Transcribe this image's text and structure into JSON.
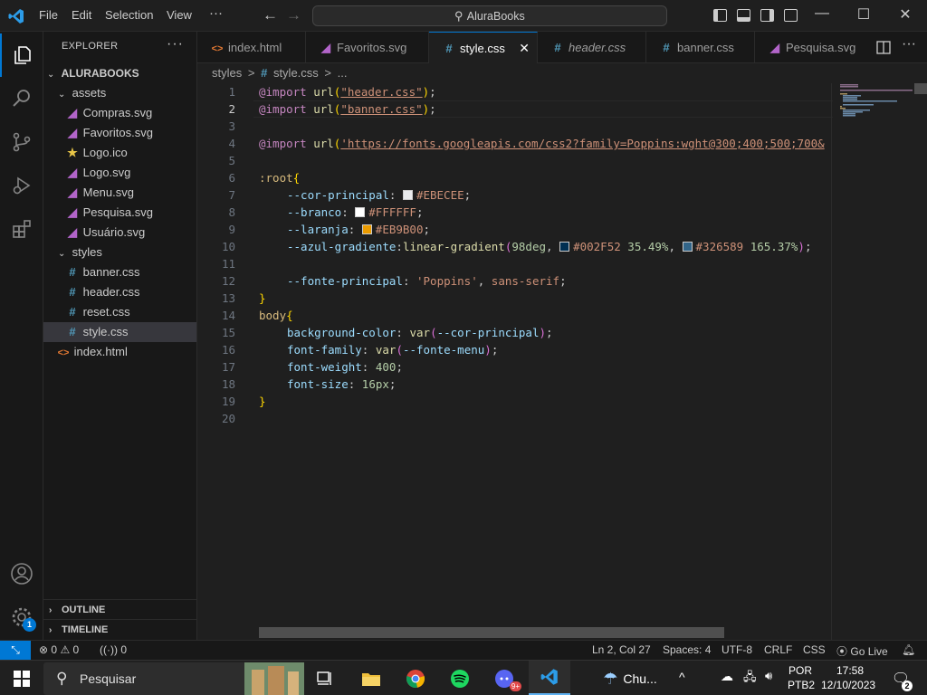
{
  "titlebar": {
    "menu": [
      "File",
      "Edit",
      "Selection",
      "View"
    ],
    "more": "···",
    "search_text": "AluraBooks",
    "minimize": "—",
    "maximize": "☐",
    "close": "✕"
  },
  "sidebar": {
    "title": "EXPLORER",
    "more": "···",
    "root": "ALURABOOKS",
    "tree": [
      {
        "label": "assets",
        "kind": "folder"
      },
      {
        "label": "Compras.svg",
        "kind": "svg"
      },
      {
        "label": "Favoritos.svg",
        "kind": "svg"
      },
      {
        "label": "Logo.ico",
        "kind": "ico"
      },
      {
        "label": "Logo.svg",
        "kind": "svg"
      },
      {
        "label": "Menu.svg",
        "kind": "svg"
      },
      {
        "label": "Pesquisa.svg",
        "kind": "svg"
      },
      {
        "label": "Usuário.svg",
        "kind": "svg"
      },
      {
        "label": "styles",
        "kind": "folder"
      },
      {
        "label": "banner.css",
        "kind": "css"
      },
      {
        "label": "header.css",
        "kind": "css"
      },
      {
        "label": "reset.css",
        "kind": "css"
      },
      {
        "label": "style.css",
        "kind": "css"
      },
      {
        "label": "index.html",
        "kind": "html"
      }
    ],
    "outline": "OUTLINE",
    "timeline": "TIMELINE"
  },
  "tabs": [
    {
      "label": "index.html",
      "icon": "<>"
    },
    {
      "label": "Favoritos.svg",
      "icon": "svg"
    },
    {
      "label": "style.css",
      "icon": "#"
    },
    {
      "label": "header.css",
      "icon": "#"
    },
    {
      "label": "banner.css",
      "icon": "#"
    },
    {
      "label": "Pesquisa.svg",
      "icon": "svg"
    }
  ],
  "breadcrumbs": {
    "folder": "styles",
    "sep": ">",
    "file": "style.css",
    "more": "..."
  },
  "editor": {
    "line_numbers": [
      "1",
      "2",
      "3",
      "4",
      "5",
      "6",
      "7",
      "8",
      "9",
      "10",
      "11",
      "12",
      "13",
      "14",
      "15",
      "16",
      "17",
      "18",
      "19",
      "20"
    ],
    "code": {
      "import1_kw": "@import",
      "import1_fn": "url",
      "import1_str": "\"header.css\"",
      "import2_str": "\"banner.css\"",
      "import3_str": "'https://fonts.googleapis.com/css2?family=Poppins:wght@300;400;500;700&",
      "root_sel": ":root",
      "var1_name": "--cor-principal",
      "var1_val": "#EBECEE",
      "var2_name": "--branco",
      "var2_val": "#FFFFFF",
      "var3_name": "--laranja",
      "var3_val": "#EB9B00",
      "var4_name": "--azul-gradiente",
      "var4_fn": "linear-gradient",
      "var4_angle": "98deg",
      "var4_c1": "#002F52",
      "var4_p1": "35.49%",
      "var4_c2": "#326589",
      "var4_p2": "165.37%",
      "var5_name": "--fonte-principal",
      "var5_str": "'Poppins'",
      "var5_rest": "sans-serif",
      "body_sel": "body",
      "bg_prop": "background-color",
      "bg_fn": "var",
      "bg_var": "--cor-principal",
      "ff_prop": "font-family",
      "ff_var": "--fonte-menu",
      "fw_prop": "font-weight",
      "fw_val": "400",
      "fs_prop": "font-size",
      "fs_val": "16px"
    }
  },
  "statusbar": {
    "errors": "0",
    "warnings": "0",
    "ports": "0",
    "cursor": "Ln 2, Col 27",
    "spaces": "Spaces: 4",
    "encoding": "UTF-8",
    "eol": "CRLF",
    "language": "CSS",
    "golive": "Go Live"
  },
  "taskbar": {
    "search_placeholder": "Pesquisar",
    "weather": "Chu...",
    "lang1": "POR",
    "lang2": "PTB2",
    "time": "17:58",
    "date": "12/10/2023",
    "notif_count": "2",
    "discord_badge": "9+"
  },
  "activity_badge": "1",
  "colors": {
    "accent": "#0078d4",
    "swatch1": "#EBECEE",
    "swatch2": "#FFFFFF",
    "swatch3": "#EB9B00",
    "swatch4": "#002F52",
    "swatch5": "#326589"
  }
}
